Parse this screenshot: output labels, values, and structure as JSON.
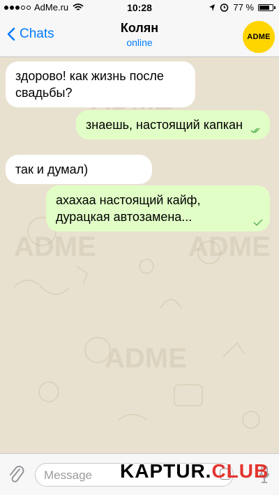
{
  "status_bar": {
    "carrier": "AdMe.ru",
    "time": "10:28",
    "battery": "77 %",
    "battery_level": 0.77
  },
  "header": {
    "back_label": "Chats",
    "title": "Колян",
    "subtitle": "online",
    "avatar_text": "ADME"
  },
  "messages": [
    {
      "direction": "in",
      "text": "здорово! как жизнь после свадьбы?"
    },
    {
      "direction": "out",
      "text": "знаешь, настоящий капкан",
      "status": "read"
    },
    {
      "direction": "in",
      "text": "так и думал)"
    },
    {
      "direction": "out",
      "text": "ахахаа настоящий кайф, дурацкая автозамена...",
      "status": "sent"
    }
  ],
  "composer": {
    "placeholder": "Message"
  },
  "watermark": "ADME",
  "site_brand": {
    "main": "KAPTUR.",
    "accent": "CLUB"
  },
  "colors": {
    "accent": "#007aff",
    "outgoing_bubble": "#e1fec6",
    "incoming_bubble": "#ffffff",
    "chat_background": "#e9e1cf",
    "check": "#4fae4e"
  }
}
